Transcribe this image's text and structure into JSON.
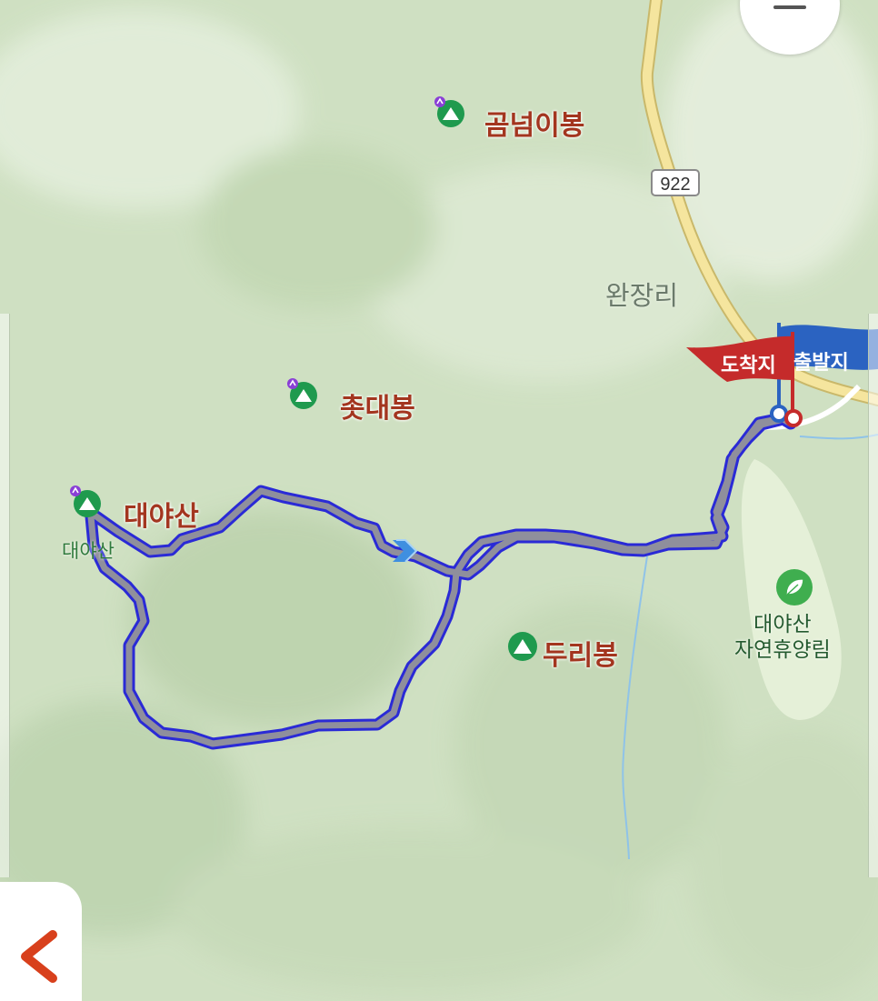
{
  "map": {
    "peaks": [
      {
        "name": "곰넘이봉"
      },
      {
        "name": "촛대봉"
      },
      {
        "name": "대야산"
      },
      {
        "name": "두리봉"
      }
    ],
    "peak_sublabel": "대야산",
    "village": "완장리",
    "road_number": "922",
    "park": {
      "line1": "대야산",
      "line2": "자연휴양림"
    },
    "flags": {
      "arrival": "도착지",
      "departure": "출발지"
    },
    "colors": {
      "route_outer": "#2a2ad6",
      "route_inner": "#8f8f9c",
      "arrival_flag": "#c52b2b",
      "departure_flag": "#2b63c1",
      "peak_icon": "#1f9a4e",
      "road": "#f3e19a"
    }
  },
  "controls": {
    "zoom_out_icon": "minus-icon",
    "back_icon": "chevron-left-icon"
  }
}
